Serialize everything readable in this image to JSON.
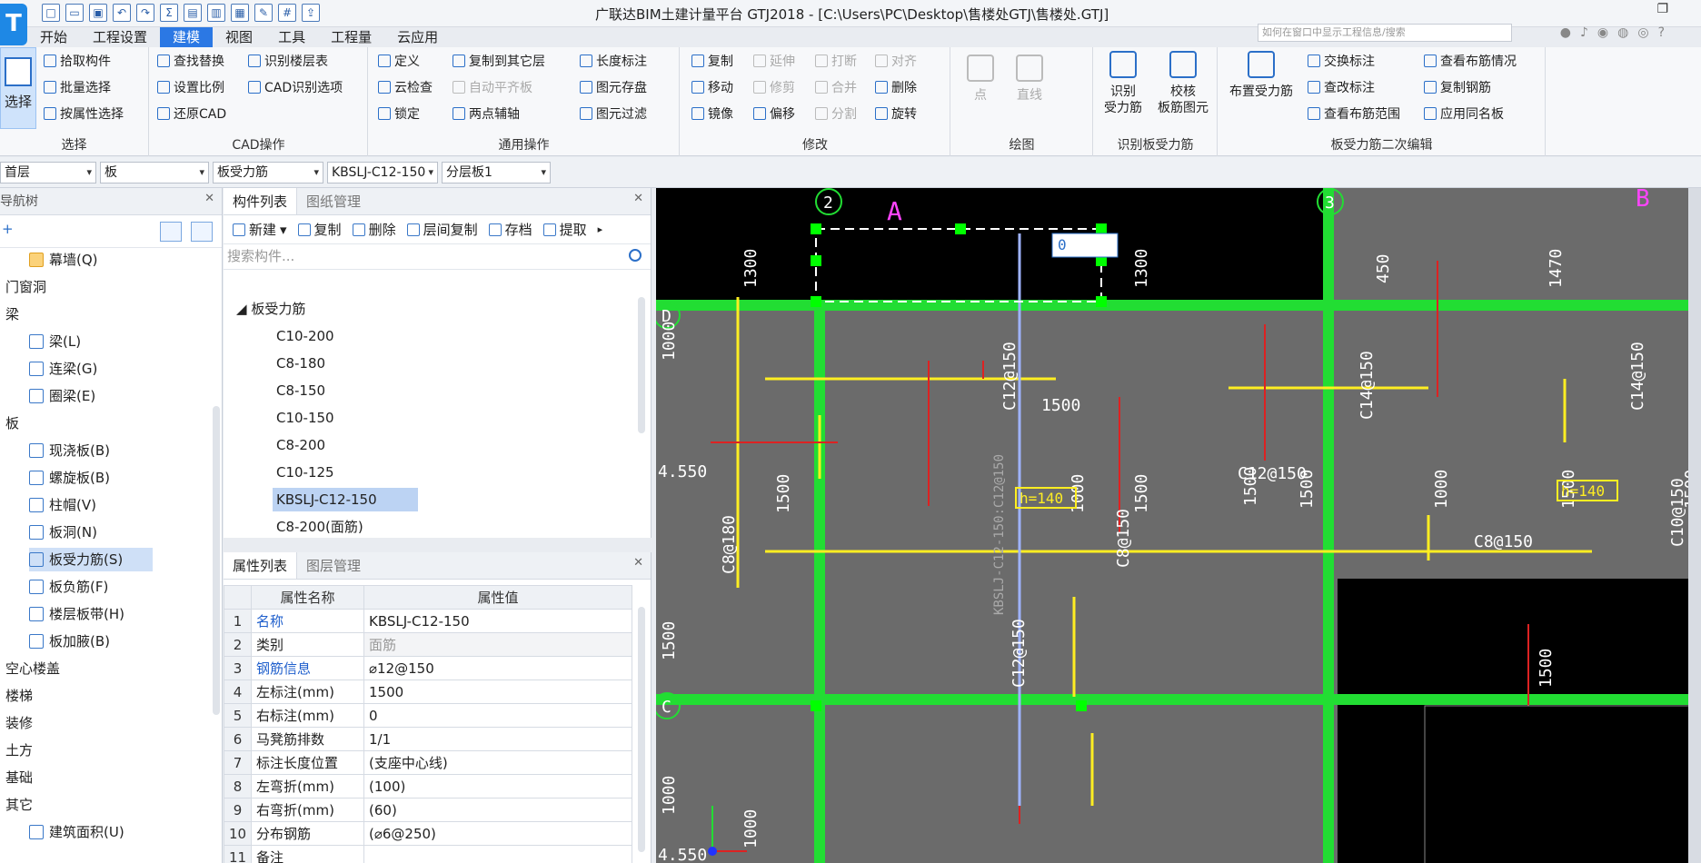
{
  "app": {
    "title": "广联达BIM土建计量平台 GTJ2018 - [C:\\Users\\PC\\Desktop\\售楼处GTJ\\售楼处.GTJ]",
    "logo": "T",
    "help_placeholder": "如何在窗口中显示工程信息/搜索"
  },
  "menu": [
    "开始",
    "工程设置",
    "建模",
    "视图",
    "工具",
    "工程量",
    "云应用"
  ],
  "ribbon": {
    "select": {
      "big": "选择",
      "items": [
        "拾取构件",
        "批量选择",
        "按属性选择"
      ],
      "label": "选择"
    },
    "cad": {
      "col1": [
        "查找替换",
        "设置比例",
        "还原CAD"
      ],
      "col2": [
        "识别楼层表",
        "CAD识别选项"
      ],
      "label": "CAD操作"
    },
    "general": {
      "col1": [
        "定义",
        "云检查",
        "锁定"
      ],
      "col2": [
        "复制到其它层",
        "自动平齐板",
        "两点辅轴"
      ],
      "col3": [
        "长度标注",
        "图元存盘",
        "图元过滤"
      ],
      "label": "通用操作"
    },
    "modify": {
      "col1": [
        "复制",
        "移动",
        "镜像"
      ],
      "col2": [
        "延伸",
        "修剪",
        "偏移"
      ],
      "col3": [
        "打断",
        "合并",
        "分割"
      ],
      "col4": [
        "对齐",
        "删除",
        "旋转"
      ],
      "label": "修改"
    },
    "draw": {
      "items": [
        "点",
        "直线"
      ],
      "label": "绘图"
    },
    "identify": {
      "b1": "识别\n受力筋",
      "b2": "校核\n板筋图元",
      "label": "识别板受力筋"
    },
    "edit2": {
      "big": "布置受力筋",
      "col1": [
        "交换标注",
        "查改标注",
        "查看布筋范围"
      ],
      "col2": [
        "查看布筋情况",
        "复制钢筋",
        "应用同名板"
      ],
      "label": "板受力筋二次编辑"
    }
  },
  "combos": [
    "首层",
    "板",
    "板受力筋",
    "KBSLJ-C12-150",
    "分层板1"
  ],
  "nav": {
    "title": "导航树",
    "items": [
      {
        "label": "幕墙(Q)",
        "level": 2,
        "icon": "curtain-wall-icon"
      },
      {
        "label": "门窗洞",
        "level": 1
      },
      {
        "label": "梁",
        "level": 1
      },
      {
        "label": "梁(L)",
        "level": 2,
        "icon": "beam-icon"
      },
      {
        "label": "连梁(G)",
        "level": 2,
        "icon": "coupling-beam-icon"
      },
      {
        "label": "圈梁(E)",
        "level": 2,
        "icon": "ring-beam-icon"
      },
      {
        "label": "板",
        "level": 1
      },
      {
        "label": "现浇板(B)",
        "level": 2,
        "icon": "cast-slab-icon"
      },
      {
        "label": "螺旋板(B)",
        "level": 2,
        "icon": "spiral-slab-icon"
      },
      {
        "label": "柱帽(V)",
        "level": 2,
        "icon": "column-cap-icon"
      },
      {
        "label": "板洞(N)",
        "level": 2,
        "icon": "slab-hole-icon"
      },
      {
        "label": "板受力筋(S)",
        "level": 2,
        "icon": "slab-rebar-icon",
        "selected": true
      },
      {
        "label": "板负筋(F)",
        "level": 2,
        "icon": "negative-rebar-icon"
      },
      {
        "label": "楼层板带(H)",
        "level": 2,
        "icon": "floor-strip-icon"
      },
      {
        "label": "板加腋(B)",
        "level": 2,
        "icon": "slab-haunch-icon"
      },
      {
        "label": "空心楼盖",
        "level": 1
      },
      {
        "label": "楼梯",
        "level": 1
      },
      {
        "label": "装修",
        "level": 1
      },
      {
        "label": "土方",
        "level": 1
      },
      {
        "label": "基础",
        "level": 1
      },
      {
        "label": "其它",
        "level": 1
      },
      {
        "label": "建筑面积(U)",
        "level": 2,
        "icon": "building-area-icon"
      }
    ]
  },
  "component_list": {
    "tabs": [
      "构件列表",
      "图纸管理"
    ],
    "tools": [
      "新建",
      "复制",
      "删除",
      "层间复制",
      "存档",
      "提取"
    ],
    "search_placeholder": "搜索构件...",
    "group": "板受力筋",
    "items": [
      "C10-200",
      "C8-180",
      "C8-150",
      "C10-150",
      "C8-200",
      "C10-125",
      "KBSLJ-C12-150",
      "C8-200(面筋)"
    ],
    "selected": "KBSLJ-C12-150"
  },
  "property_list": {
    "tabs": [
      "属性列表",
      "图层管理"
    ],
    "headers": [
      "属性名称",
      "属性值"
    ],
    "rows": [
      {
        "n": "1",
        "name": "名称",
        "value": "KBSLJ-C12-150",
        "link": true
      },
      {
        "n": "2",
        "name": "类别",
        "value": "面筋",
        "gray": true
      },
      {
        "n": "3",
        "name": "钢筋信息",
        "value": "⌀12@150",
        "link": true
      },
      {
        "n": "4",
        "name": "左标注(mm)",
        "value": "1500"
      },
      {
        "n": "5",
        "name": "右标注(mm)",
        "value": "0"
      },
      {
        "n": "6",
        "name": "马凳筋排数",
        "value": "1/1"
      },
      {
        "n": "7",
        "name": "标注长度位置",
        "value": "(支座中心线)"
      },
      {
        "n": "8",
        "name": "左弯折(mm)",
        "value": "(100)"
      },
      {
        "n": "9",
        "name": "右弯折(mm)",
        "value": "(60)"
      },
      {
        "n": "10",
        "name": "分布钢筋",
        "value": "(⌀6@250)"
      },
      {
        "n": "11",
        "name": "备注",
        "value": ""
      }
    ]
  },
  "canvas": {
    "axis_labels": [
      "2",
      "3",
      "D",
      "C",
      "A",
      "B"
    ],
    "dims": [
      "1300",
      "1300",
      "450",
      "1470",
      "1000",
      "1500",
      "1500",
      "1000",
      "1500",
      "1500",
      "1500",
      "1000",
      "1500",
      "1500",
      "1500",
      "1000",
      "1000",
      "1500"
    ],
    "rebar_labels": [
      "C12@150",
      "C14@150",
      "C14@150",
      "C12@150",
      "C8@180",
      "C8@150",
      "C8@150",
      "C8@150",
      "C10@150",
      "C12@150"
    ],
    "slab_tags": [
      "h=140",
      "h=140"
    ],
    "long_label": "KBSLJ-C12-150:C12@150",
    "elev": [
      "4.550",
      "4.550"
    ],
    "input_value": "0"
  }
}
